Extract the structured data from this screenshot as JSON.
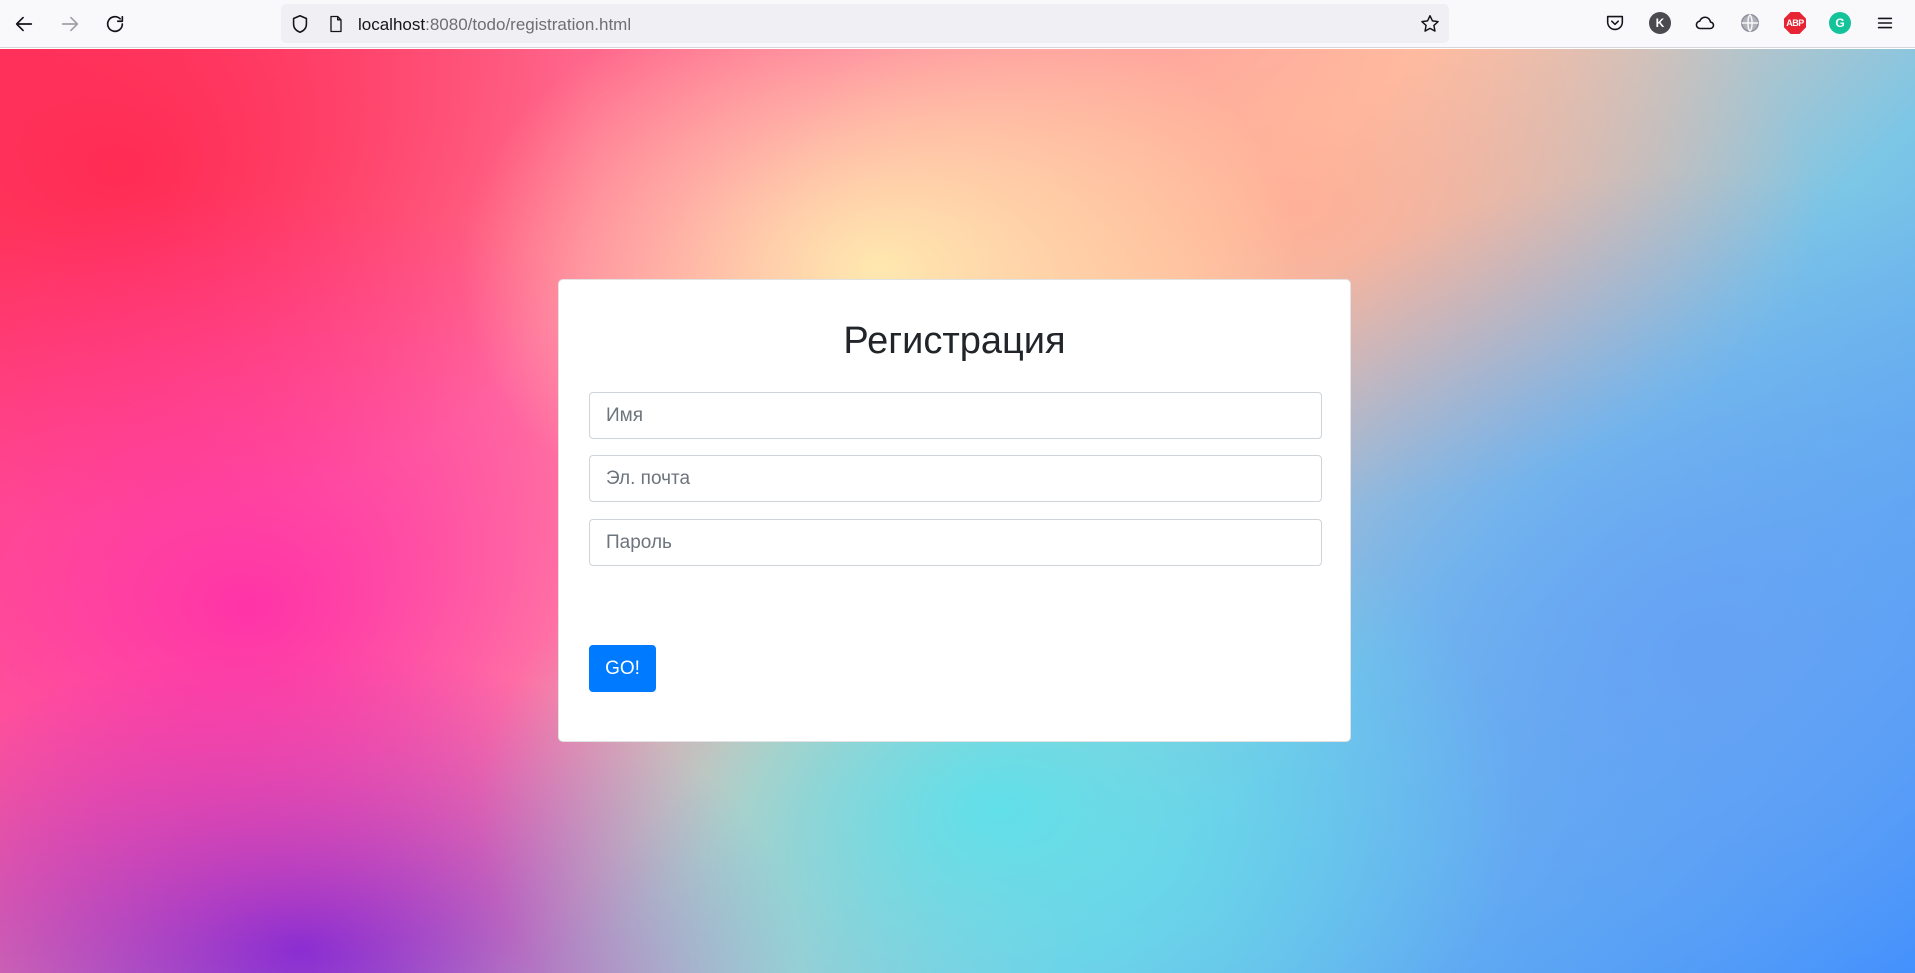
{
  "browser": {
    "url_host": "localhost",
    "url_rest": ":8080/todo/registration.html",
    "extensions": [
      {
        "name": "pocket-icon"
      },
      {
        "name": "k-extension-icon",
        "letter": "K",
        "color": "#4a4a4f"
      },
      {
        "name": "cloud-icon"
      },
      {
        "name": "globe-icon"
      },
      {
        "name": "adblock-icon",
        "letter": "ABP",
        "color": "#e62433"
      },
      {
        "name": "grammarly-icon",
        "letter": "G",
        "color": "#15c39a"
      }
    ]
  },
  "form": {
    "title": "Регистрация",
    "name_placeholder": "Имя",
    "email_placeholder": "Эл. почта",
    "password_placeholder": "Пароль",
    "submit_label": "GO!"
  },
  "colors": {
    "primary": "#007bff"
  }
}
